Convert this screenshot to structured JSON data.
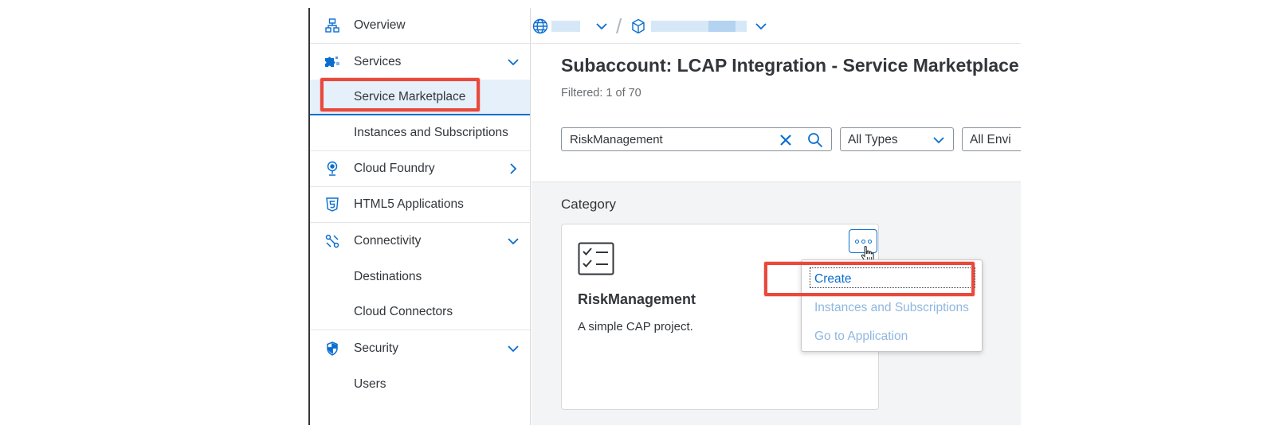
{
  "sidebar": {
    "items": [
      {
        "label": "Overview"
      },
      {
        "label": "Services"
      },
      {
        "label": "Service Marketplace"
      },
      {
        "label": "Instances and Subscriptions"
      },
      {
        "label": "Cloud Foundry"
      },
      {
        "label": "HTML5 Applications"
      },
      {
        "label": "Connectivity"
      },
      {
        "label": "Destinations"
      },
      {
        "label": "Cloud Connectors"
      },
      {
        "label": "Security"
      },
      {
        "label": "Users"
      }
    ]
  },
  "breadcrumb": {
    "separator": "/"
  },
  "main": {
    "title": "Subaccount: LCAP Integration - Service Marketplace",
    "filtered": "Filtered: 1 of 70",
    "search": {
      "value": "RiskManagement"
    },
    "type_filter": "All Types",
    "env_filter": "All Envi",
    "category_label": "Category",
    "tile": {
      "title": "RiskManagement",
      "description": "A simple CAP project."
    },
    "menu": {
      "items": [
        {
          "label": "Create"
        },
        {
          "label": "Instances and Subscriptions"
        },
        {
          "label": "Go to Application"
        }
      ]
    }
  },
  "colors": {
    "accent": "#0a6ed1",
    "highlight": "#e9493b",
    "text": "#32363a",
    "selected_bg": "#e5f0fa"
  },
  "icons": {
    "overview": "hierarchy-icon",
    "services": "puzzle-icon",
    "cloud_foundry": "pin-icon",
    "html5": "html5-icon",
    "connectivity": "connection-icon",
    "security": "shield-icon"
  }
}
